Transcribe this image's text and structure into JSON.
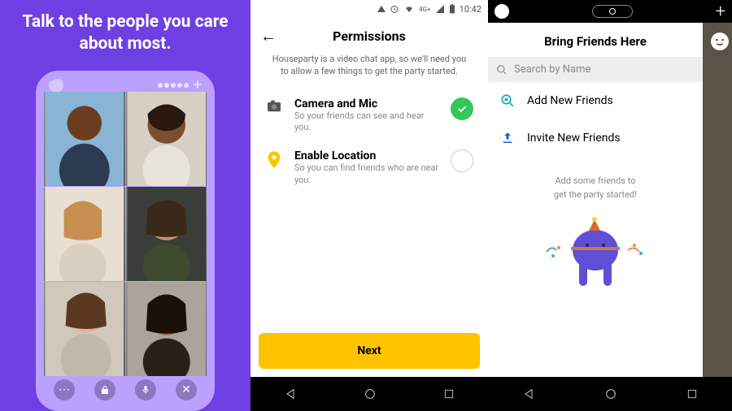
{
  "panel1": {
    "headline": "Talk to the people you care about most."
  },
  "panel2": {
    "status_time": "10:42",
    "status_net": "4G+",
    "title": "Permissions",
    "subtitle": "Houseparty is a video chat app, so we'll need you to allow a few things to get the party started.",
    "perms": [
      {
        "title": "Camera and Mic",
        "desc": "So your friends can see and hear you.",
        "granted": true
      },
      {
        "title": "Enable Location",
        "desc": "So you can find friends who are near you.",
        "granted": false
      }
    ],
    "next_label": "Next"
  },
  "panel3": {
    "title": "Bring Friends Here",
    "search_placeholder": "Search by Name",
    "menu": [
      {
        "label": "Add New Friends"
      },
      {
        "label": "Invite New Friends"
      }
    ],
    "empty_line1": "Add some friends to",
    "empty_line2": "get the party started!"
  }
}
